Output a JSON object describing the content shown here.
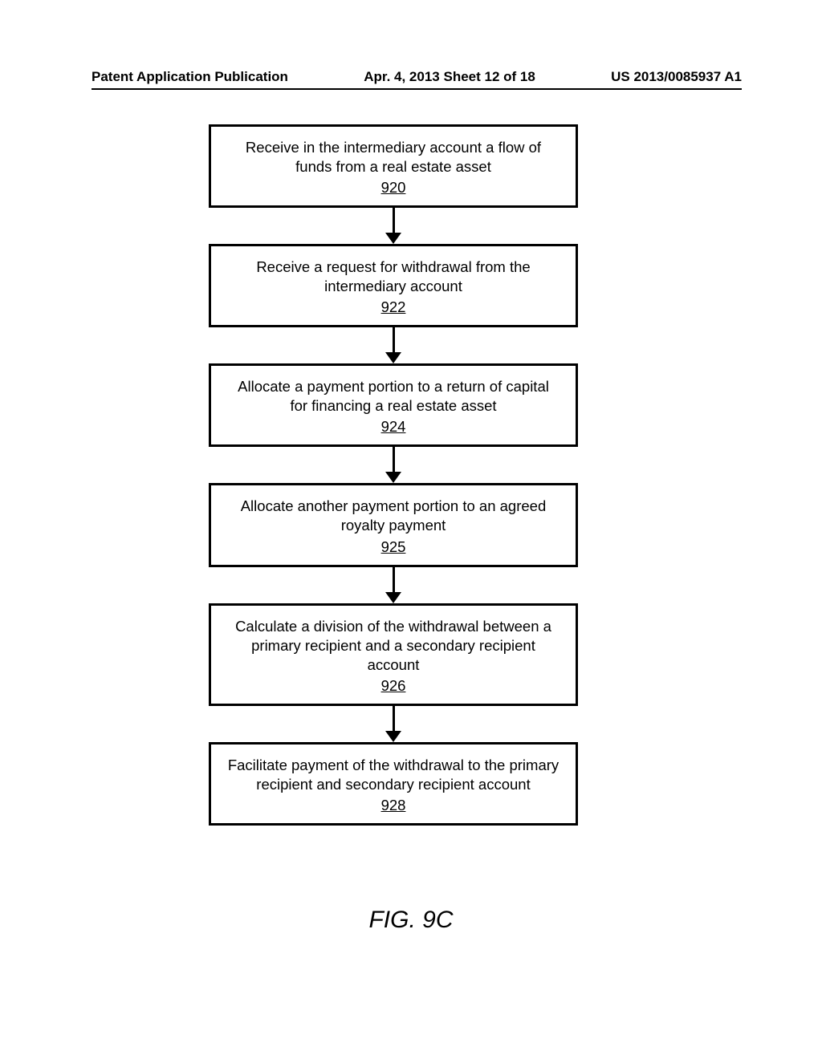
{
  "header": {
    "left": "Patent Application Publication",
    "center": "Apr. 4, 2013  Sheet 12 of 18",
    "right": "US 2013/0085937 A1"
  },
  "flowchart": {
    "boxes": [
      {
        "text": "Receive in the intermediary account a flow of funds from a real estate asset",
        "ref": "920"
      },
      {
        "text": "Receive a request for withdrawal from the intermediary account",
        "ref": "922"
      },
      {
        "text": "Allocate a payment portion to a return of capital for financing a real estate asset",
        "ref": "924"
      },
      {
        "text": "Allocate another payment portion to an agreed royalty payment",
        "ref": "925"
      },
      {
        "text": "Calculate a division of the withdrawal between a primary recipient and a secondary recipient account",
        "ref": "926"
      },
      {
        "text": "Facilitate payment of the withdrawal to the primary recipient and secondary recipient account",
        "ref": "928"
      }
    ]
  },
  "figure_label": "FIG. 9C"
}
